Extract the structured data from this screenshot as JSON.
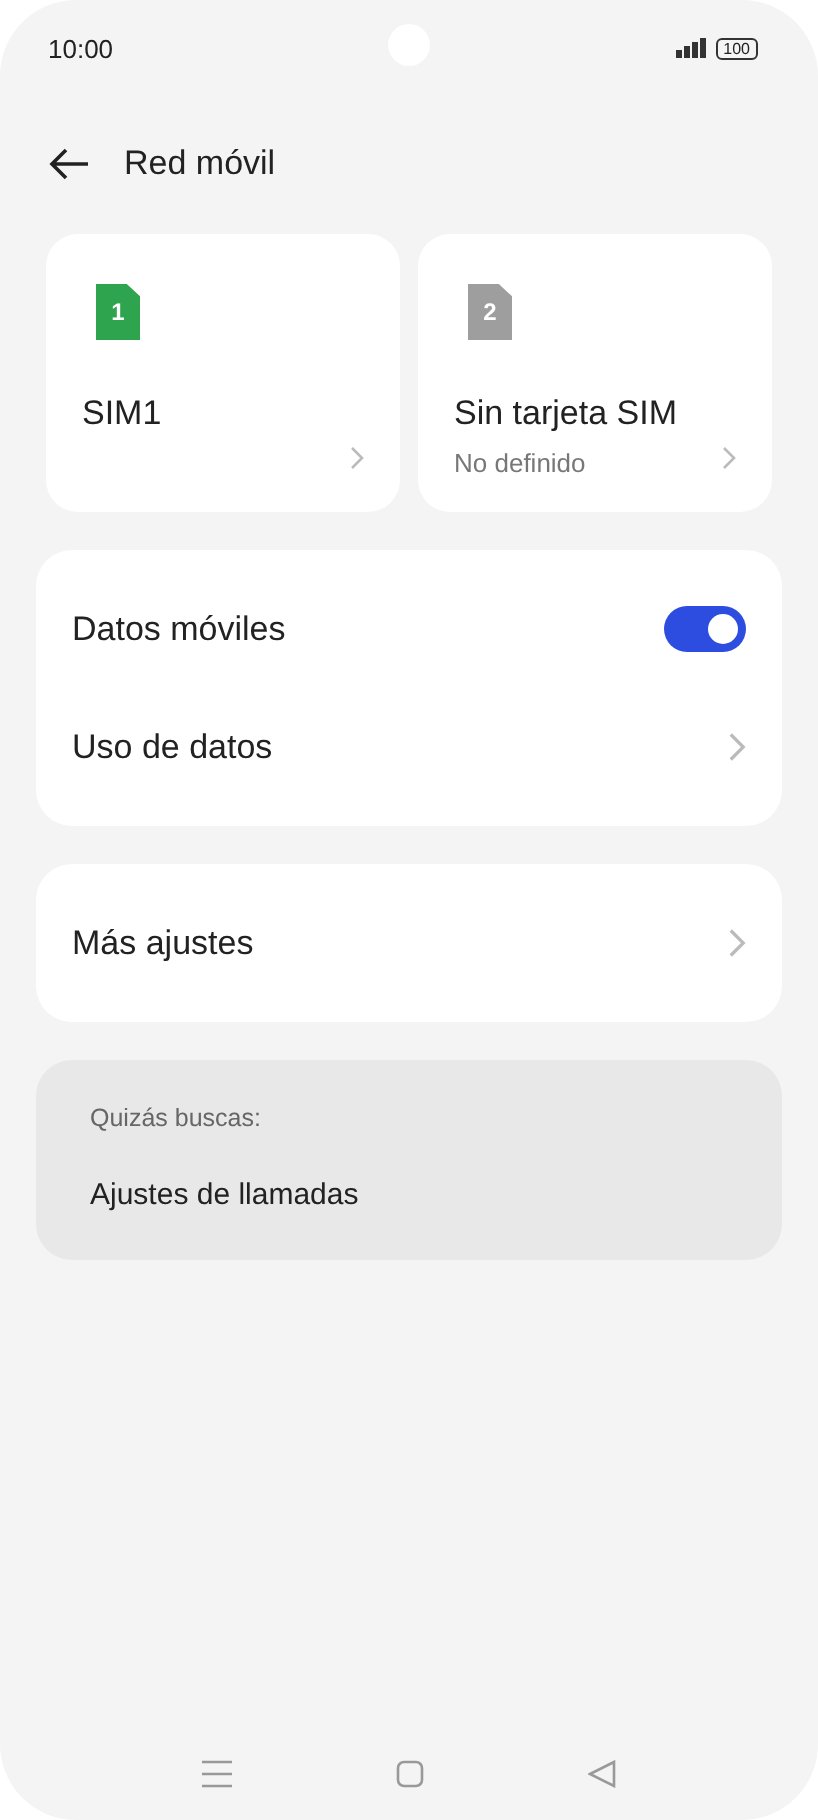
{
  "status_bar": {
    "time": "10:00",
    "battery": "100"
  },
  "header": {
    "title": "Red móvil"
  },
  "sims": [
    {
      "number": "1",
      "label": "SIM1",
      "color": "#2ea44f"
    },
    {
      "number": "2",
      "label": "Sin tarjeta SIM",
      "subtitle": "No definido",
      "color": "#9e9e9e"
    }
  ],
  "groups": [
    [
      {
        "kind": "toggle",
        "label": "Datos móviles",
        "on": true
      },
      {
        "kind": "link",
        "label": "Uso de datos"
      }
    ],
    [
      {
        "kind": "link",
        "label": "Más ajustes"
      }
    ]
  ],
  "suggestions": {
    "heading": "Quizás buscas:",
    "items": [
      "Ajustes de llamadas"
    ]
  }
}
